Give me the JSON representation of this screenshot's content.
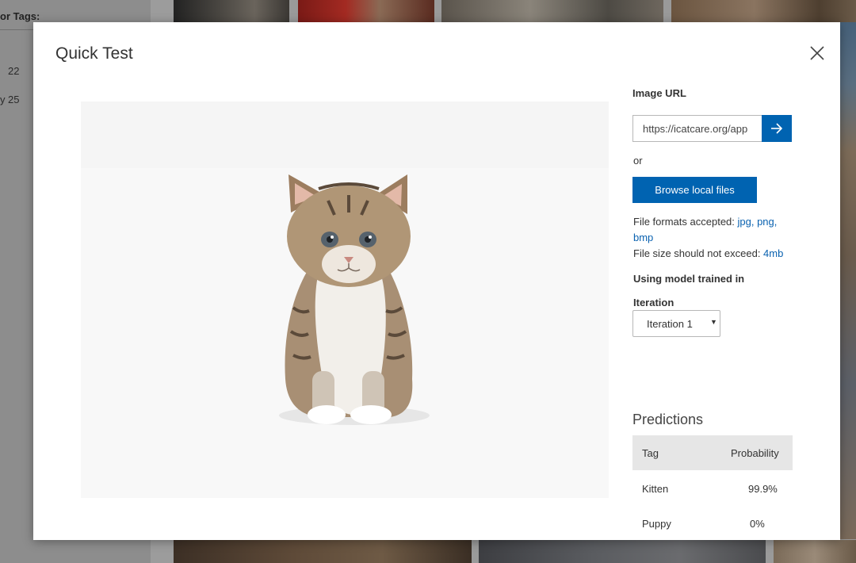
{
  "background": {
    "sidebar_label": "or Tags:",
    "counts": [
      {
        "prefix": "",
        "value": "22"
      },
      {
        "prefix": "y",
        "value": "25"
      }
    ]
  },
  "modal": {
    "title": "Quick Test",
    "close_icon": "close-icon"
  },
  "panel": {
    "image_url_label": "Image URL",
    "image_url_value": "https://icatcare.org/app",
    "go_icon": "arrow-right-icon",
    "or_text": "or",
    "browse_label": "Browse local files",
    "formats_prefix": "File formats accepted: ",
    "formats": "jpg, png, bmp",
    "size_prefix": "File size should not exceed: ",
    "size_limit": "4mb",
    "model_label": "Using model trained in",
    "iteration_label": "Iteration",
    "iteration_value": "Iteration 1"
  },
  "predictions": {
    "title": "Predictions",
    "headers": {
      "tag": "Tag",
      "probability": "Probability"
    },
    "rows": [
      {
        "tag": "Kitten",
        "probability": "99.9%"
      },
      {
        "tag": "Puppy",
        "probability": "0%"
      }
    ]
  },
  "colors": {
    "accent": "#0063b1",
    "link": "#0a62b0",
    "overlay": "#9a9a9a"
  }
}
